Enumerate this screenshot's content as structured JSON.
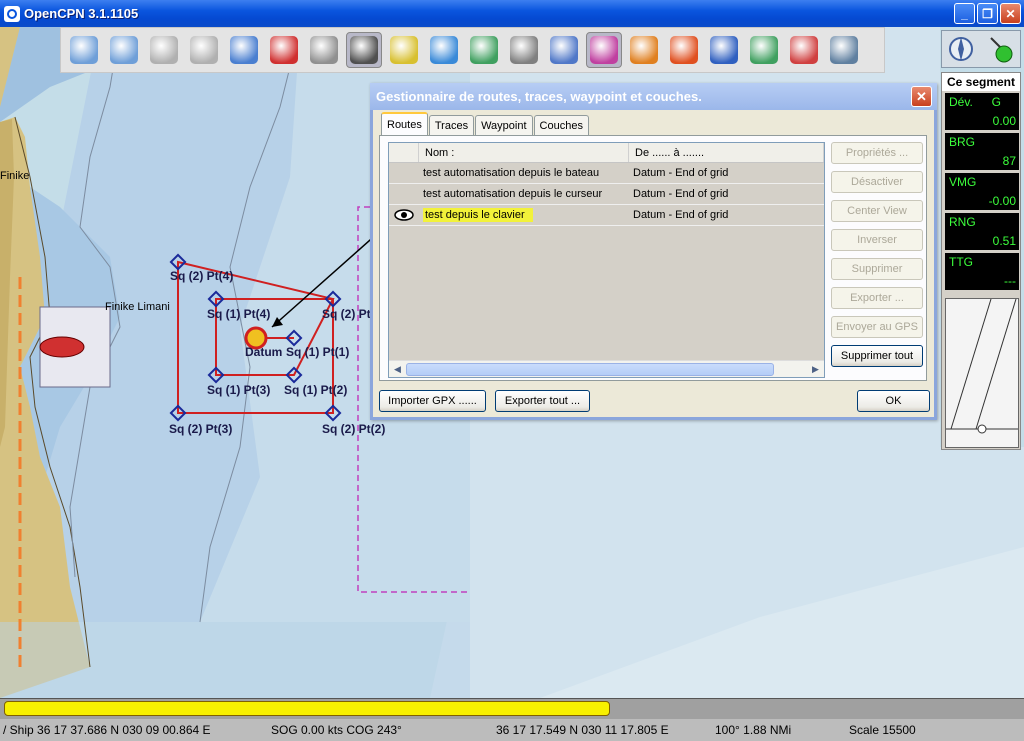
{
  "window": {
    "title": "OpenCPN 3.1.1105"
  },
  "toolbar": {
    "items": [
      {
        "name": "zoom-in-icon",
        "color": "#6f9fd8"
      },
      {
        "name": "zoom-out-icon",
        "color": "#6f9fd8"
      },
      {
        "name": "scale-down-icon",
        "color": "#b0b0b0"
      },
      {
        "name": "scale-up-icon",
        "color": "#b0b0b0"
      },
      {
        "name": "route-icon",
        "color": "#4a7fd0"
      },
      {
        "name": "follow-ship-icon",
        "color": "#d03030"
      },
      {
        "name": "settings-icon",
        "color": "#909090"
      },
      {
        "name": "text-icon",
        "color": "#505050",
        "active": true
      },
      {
        "name": "current-icon",
        "color": "#d8c030"
      },
      {
        "name": "tide-icon",
        "color": "#3a8ad8"
      },
      {
        "name": "chart-quilt-icon",
        "color": "#40a060"
      },
      {
        "name": "print-icon",
        "color": "#808080"
      },
      {
        "name": "route-manager-icon",
        "color": "#5078c8"
      },
      {
        "name": "track-icon",
        "color": "#c040a0",
        "active": true
      },
      {
        "name": "color-scheme-icon",
        "color": "#e08020"
      },
      {
        "name": "mob-icon",
        "color": "#e05020"
      },
      {
        "name": "help-icon",
        "color": "#3060c0"
      },
      {
        "name": "plugin-icon",
        "color": "#40a060"
      },
      {
        "name": "ais-icon",
        "color": "#d04040"
      },
      {
        "name": "about-icon",
        "color": "#6080a0"
      }
    ]
  },
  "dashboard": {
    "title": "Ce segment",
    "cells": [
      {
        "label": "Dév.",
        "unit": "G",
        "value": "0.00"
      },
      {
        "label": "BRG",
        "unit": "",
        "value": "87"
      },
      {
        "label": "VMG",
        "unit": "",
        "value": "-0.00"
      },
      {
        "label": "RNG",
        "unit": "",
        "value": "0.51"
      },
      {
        "label": "TTG",
        "unit": "",
        "value": "---"
      }
    ]
  },
  "map_labels": {
    "finike": "Finike",
    "finike_limani": "Finike Limani",
    "waypoints": [
      "Sq (2) Pt(4)",
      "Sq (1) Pt(4)",
      "Sq (2) Pt",
      "Datum",
      "Sq (1) Pt(1)",
      "Sq (1) Pt(3)",
      "Sq (1) Pt(2)",
      "Sq (2) Pt(3)",
      "Sq (2) Pt(2)"
    ]
  },
  "dialog": {
    "title": "Gestionnaire de routes, traces, waypoint et couches.",
    "tabs": [
      "Routes",
      "Traces",
      "Waypoint",
      "Couches"
    ],
    "columns": [
      "",
      "Nom :",
      "De ...... à ......."
    ],
    "rows": [
      {
        "visible": false,
        "name": "test automatisation depuis le bateau",
        "span": "Datum - End of grid"
      },
      {
        "visible": false,
        "name": "test automatisation depuis le curseur",
        "span": "Datum - End of grid"
      },
      {
        "visible": true,
        "name": "test depuis le clavier",
        "span": "Datum - End of grid"
      }
    ],
    "side_buttons": [
      {
        "label": "Propriétés ...",
        "disabled": true
      },
      {
        "label": "Désactiver",
        "disabled": true
      },
      {
        "label": "Center View",
        "disabled": true
      },
      {
        "label": "Inverser",
        "disabled": true
      },
      {
        "label": "Supprimer",
        "disabled": true
      },
      {
        "label": "Exporter ...",
        "disabled": true
      },
      {
        "label": "Envoyer au GPS",
        "disabled": true
      },
      {
        "label": "Supprimer tout",
        "disabled": false
      }
    ],
    "import_label": "Importer GPX ......",
    "export_label": "Exporter tout ...",
    "ok_label": "OK"
  },
  "statusbar": {
    "ship": "/ Ship 36 17 37.686 N   030 09 00.864 E",
    "sog": "SOG 0.00 kts  COG 243°",
    "cursor": "36 17 17.549 N   030 11 17.805 E",
    "bearing": "100°  1.88 NMi",
    "scale": "Scale 15500"
  }
}
